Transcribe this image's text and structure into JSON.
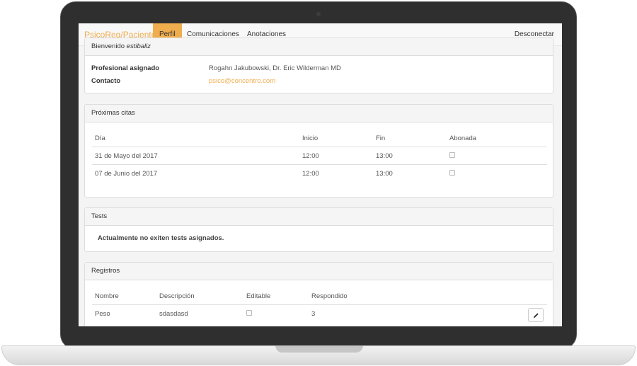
{
  "navbar": {
    "brand": "PsicoReg/Paciente",
    "items": [
      {
        "label": "Perfil",
        "active": true
      },
      {
        "label": "Comunicaciones",
        "active": false
      },
      {
        "label": "Anotaciones",
        "active": false
      }
    ],
    "logout_label": "Desconectar"
  },
  "welcome": {
    "prefix": "Bienvenido",
    "username": "estibaliz",
    "assigned_label": "Profesional asignado",
    "assigned_value": "Rogahn Jakubowski, Dr. Eric Wilderman MD",
    "contact_label": "Contacto",
    "contact_value": "psico@concentro.com"
  },
  "appointments": {
    "title": "Próximas citas",
    "columns": [
      "Día",
      "Inicio",
      "Fin",
      "Abonada"
    ],
    "rows": [
      {
        "day": "31 de Mayo del 2017",
        "start": "12:00",
        "end": "13:00",
        "paid": false
      },
      {
        "day": "07 de Junio del 2017",
        "start": "12:00",
        "end": "13:00",
        "paid": false
      }
    ]
  },
  "tests": {
    "title": "Tests",
    "empty_message": "Actualmente no exiten tests asignados."
  },
  "records": {
    "title": "Registros",
    "columns": [
      "Nombre",
      "Descripción",
      "Editable",
      "Respondido"
    ],
    "rows": [
      {
        "name": "Peso",
        "description": "sdasdasd",
        "editable": false,
        "answered": "3"
      }
    ]
  },
  "colors": {
    "accent": "#f0ad4e",
    "laptop_frame": "#2f2f2f"
  }
}
